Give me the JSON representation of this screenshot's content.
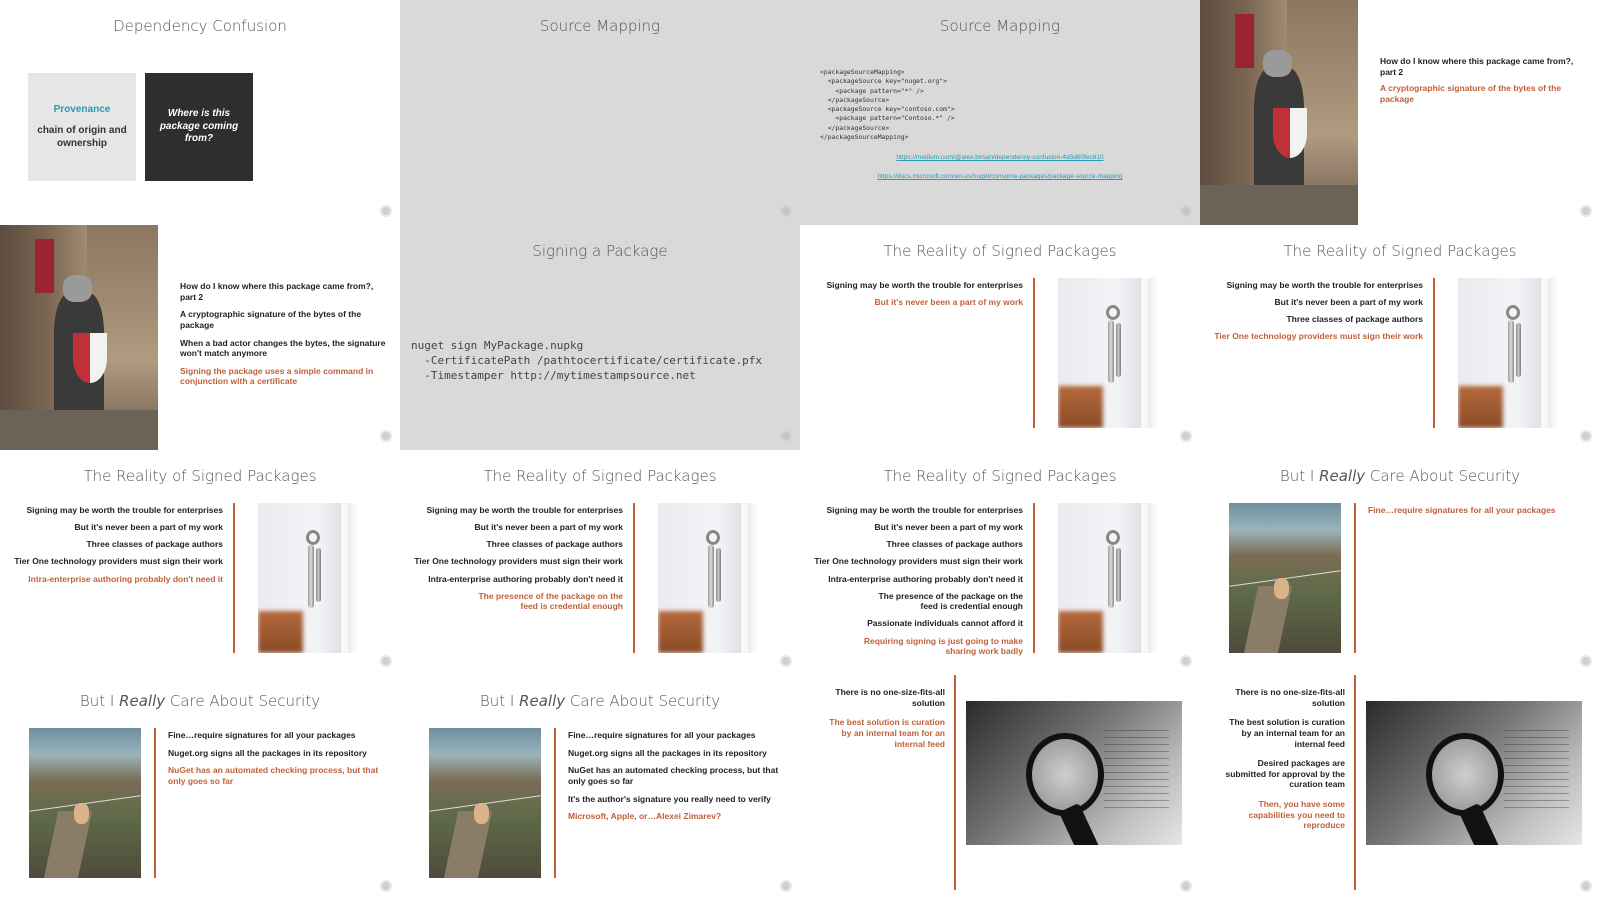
{
  "colors": {
    "accent": "#c0603a",
    "teal": "#2a9ab0",
    "gray_slide": "#d9d9d9",
    "dark_box": "#2e2e2e"
  },
  "slides": {
    "s1": {
      "title": "Dependency Confusion",
      "box1_heading": "Provenance",
      "box1_text": "chain of origin and ownership",
      "box2_text": "Where is this package coming from?"
    },
    "s2": {
      "title": "Source Mapping"
    },
    "s3": {
      "title": "Source Mapping",
      "xml": "<packageSourceMapping>\n  <packageSource key=\"nuget.org\">\n    <package pattern=\"*\" />\n  </packageSource>\n  <packageSource key=\"contoso.com\">\n    <package pattern=\"Contoso.*\" />\n  </packageSource>\n</packageSourceMapping>",
      "link1": "https://medium.com/@alex.birsan/dependency-confusion-4a5d60fec610",
      "link2": "https://docs.microsoft.com/en-us/nuget/consume-packages/package-source-mapping"
    },
    "s4": {
      "b1": "How do I know where this package came from?, part 2",
      "b2": "A cryptographic signature of the bytes of the package"
    },
    "s5": {
      "b1": "How do I know where this package came from?, part 2",
      "b2": "A cryptographic signature of the bytes of the package",
      "b3": "When a bad actor changes the bytes, the signature won't match anymore",
      "b4": "Signing the package uses a simple command in conjunction with a certificate"
    },
    "s6": {
      "title": "Signing a Package",
      "code": "nuget sign MyPackage.nupkg\n  -CertificatePath /pathtocertificate/certificate.pfx\n  -Timestamper http://mytimestampsource.net"
    },
    "s7": {
      "title": "The Reality of Signed Packages",
      "bullets": [
        "Signing may be worth the trouble for enterprises",
        "But it's never been a part of my work"
      ]
    },
    "s8": {
      "title": "The Reality of Signed Packages",
      "bullets": [
        "Signing may be worth the trouble for enterprises",
        "But it's never been a part of my work",
        "Three classes of package authors",
        "Tier One technology providers must sign their work"
      ]
    },
    "s9": {
      "title": "The Reality of Signed Packages",
      "bullets": [
        "Signing may be worth the trouble for enterprises",
        "But it's never been a part of my work",
        "Three classes of package authors",
        "Tier One technology providers must sign their work",
        "Intra-enterprise authoring probably don't need it"
      ]
    },
    "s10": {
      "title": "The Reality of Signed Packages",
      "bullets": [
        "Signing may be worth the trouble for enterprises",
        "But it's never been a part of my work",
        "Three classes of package authors",
        "Tier One technology providers must sign their work",
        "Intra-enterprise authoring probably don't need it",
        "The presence of the package on the feed is credential enough"
      ]
    },
    "s11": {
      "title": "The Reality of Signed Packages",
      "bullets": [
        "Signing may be worth the trouble for enterprises",
        "But it's never been a part of my work",
        "Three classes of package authors",
        "Tier One technology providers must sign their work",
        "Intra-enterprise authoring probably don't need it",
        "The presence of the package on the feed is credential enough",
        "Passionate individuals cannot afford it",
        "Requiring signing is just going to make sharing work badly"
      ]
    },
    "s12": {
      "title_pre": "But I ",
      "title_em": "Really",
      "title_post": " Care About Security",
      "bullets": [
        "Fine…require signatures for all your packages"
      ]
    },
    "s13": {
      "title_pre": "But I ",
      "title_em": "Really",
      "title_post": " Care About Security",
      "bullets": [
        "Fine…require signatures for all your packages",
        "Nuget.org signs all the packages in its repository",
        "NuGet has an automated checking process, but that only goes so far"
      ]
    },
    "s14": {
      "title_pre": "But I ",
      "title_em": "Really",
      "title_post": " Care About Security",
      "bullets": [
        "Fine…require signatures for all your packages",
        "Nuget.org signs all the packages in its repository",
        "NuGet has an automated checking process, but that only goes so far",
        "It's the author's signature you really need to verify",
        "Microsoft, Apple, or…Alexei Zimarev?"
      ]
    },
    "s15": {
      "bullets": [
        "There is no one-size-fits-all solution",
        "The best solution is curation by an internal team for an internal feed"
      ]
    },
    "s16": {
      "bullets": [
        "There is no one-size-fits-all solution",
        "The best solution is curation by an internal team for an internal feed",
        "Desired packages are submitted for approval by the curation team",
        "Then, you have some capabilities you need to reproduce"
      ]
    }
  }
}
